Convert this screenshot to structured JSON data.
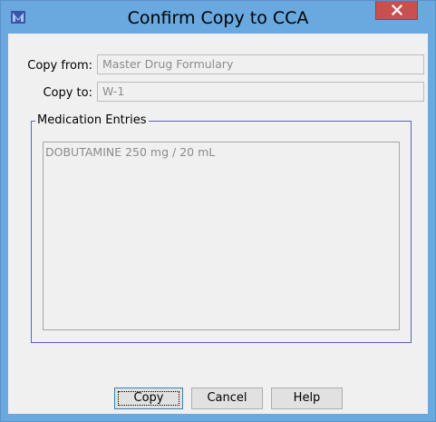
{
  "window": {
    "title": "Confirm Copy to CCA"
  },
  "icons": {
    "app": "app-logo-icon",
    "close": "close-icon"
  },
  "colors": {
    "titlebar": "#6aa9df",
    "close_button": "#c75050",
    "client_bg": "#f0f0f0",
    "group_border": "#5a66b0",
    "disabled_text": "#8c8c8c"
  },
  "form": {
    "copy_from_label": "Copy from:",
    "copy_from_value": "Master Drug Formulary",
    "copy_to_label": "Copy to:",
    "copy_to_value": "W-1"
  },
  "group": {
    "title": "Medication Entries",
    "items": [
      "DOBUTAMINE 250 mg / 20 mL"
    ]
  },
  "buttons": {
    "copy": "Copy",
    "cancel": "Cancel",
    "help": "Help"
  }
}
